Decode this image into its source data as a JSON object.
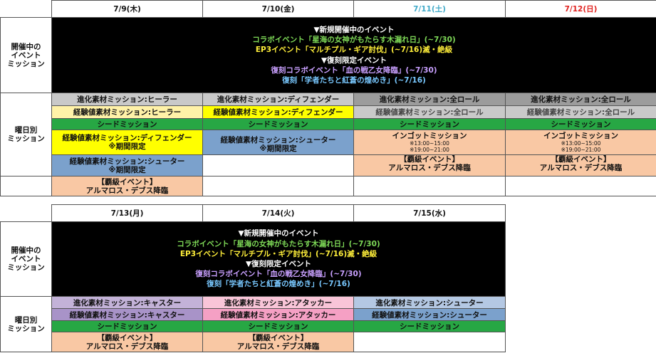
{
  "labels": {
    "event_row": [
      "開催中の",
      "イベント",
      "ミッション"
    ],
    "daily_row": [
      "曜日別",
      "ミッション"
    ]
  },
  "events": {
    "new_header": "▼新規開催中のイベント",
    "new1": "コラボイベント「星海の女神がもたらす木漏れ日」(~7/30)",
    "new2": "EP3イベント「マルチプル・ギア討伐」(~7/16)滅・絶級",
    "rerun_header": "▼復刻限定イベント",
    "rerun1": "復刻コラボイベント「血の戦乙女降臨」(~7/30)",
    "rerun2": "復刻「学者たちと紅蒼の煌めき」(~7/16)"
  },
  "week1": {
    "dates": [
      "7/9(木)",
      "7/10(金)",
      "7/11(土)",
      "7/12(日)"
    ],
    "thu": {
      "evo": "進化素材ミッション:ヒーラー",
      "exp": "経験値素材ミッション:ヒーラー",
      "seed": "シードミッション",
      "limited1": "経験値素材ミッション:ディフェンダー",
      "limited1_note": "※期間限定",
      "limited2": "経験値素材ミッション:シューター",
      "limited2_note": "※期間限定",
      "hakyu": "【覇級イベント】",
      "hakyu_name": "アルマロス・デブス降臨"
    },
    "fri": {
      "evo": "進化素材ミッション:ディフェンダー",
      "exp": "経験値素材ミッション:ディフェンダー",
      "seed": "シードミッション",
      "limited1": "経験値素材ミッション:シューター",
      "limited1_note": "※期間限定"
    },
    "sat": {
      "evo": "進化素材ミッション:全ロール",
      "exp": "経験値素材ミッション:全ロール",
      "seed": "シードミッション",
      "ingot": "インゴットミッション",
      "time1": "※13:00~15:00",
      "time2": "※19:00~21:00",
      "hakyu": "【覇級イベント】",
      "hakyu_name": "アルマロス・デブス降臨"
    },
    "sun": {
      "evo": "進化素材ミッション:全ロール",
      "exp": "経験値素材ミッション:全ロール",
      "seed": "シードミッション",
      "ingot": "インゴットミッション",
      "time1": "※13:00~15:00",
      "time2": "※19:00~21:00",
      "hakyu": "【覇級イベント】",
      "hakyu_name": "アルマロス・デブス降臨"
    }
  },
  "week2": {
    "dates": [
      "7/13(月)",
      "7/14(火)",
      "7/15(水)"
    ],
    "mon": {
      "evo": "進化素材ミッション:キャスター",
      "exp": "経験値素材ミッション:キャスター",
      "seed": "シードミッション",
      "hakyu": "【覇級イベント】",
      "hakyu_name": "アルマロス・デブス降臨"
    },
    "tue": {
      "evo": "進化素材ミッション:アタッカー",
      "exp": "経験値素材ミッション:アタッカー",
      "seed": "シードミッション",
      "hakyu": "【覇級イベント】",
      "hakyu_name": "アルマロス・デブス降臨"
    },
    "wed": {
      "evo": "進化素材ミッション:シューター",
      "exp": "経験値素材ミッション:シューター",
      "seed": "シードミッション"
    }
  }
}
